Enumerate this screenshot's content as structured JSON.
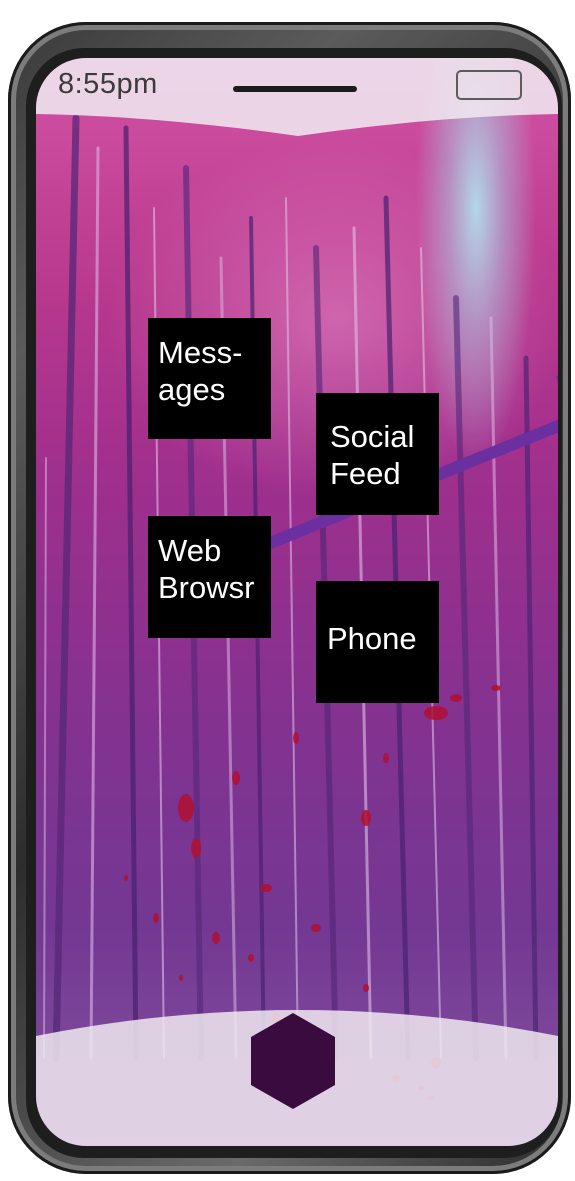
{
  "status_bar": {
    "time": "8:55pm"
  },
  "apps": [
    {
      "id": "messages",
      "label": "Mess-\nages"
    },
    {
      "id": "social-feed",
      "label": "Social\nFeed"
    },
    {
      "id": "web-browser",
      "label": "Web\nBrowsr"
    },
    {
      "id": "phone",
      "label": "Phone"
    }
  ],
  "icons": {
    "battery": "battery-icon",
    "home": "hexagon-home-icon"
  },
  "colors": {
    "tile_background": "#000000",
    "tile_text": "#ffffff",
    "drag_line": "#6b2fa0",
    "home_button": "#3a0b3f",
    "chrome_overlay": "#efe7ef",
    "splatter": "#b01030"
  }
}
